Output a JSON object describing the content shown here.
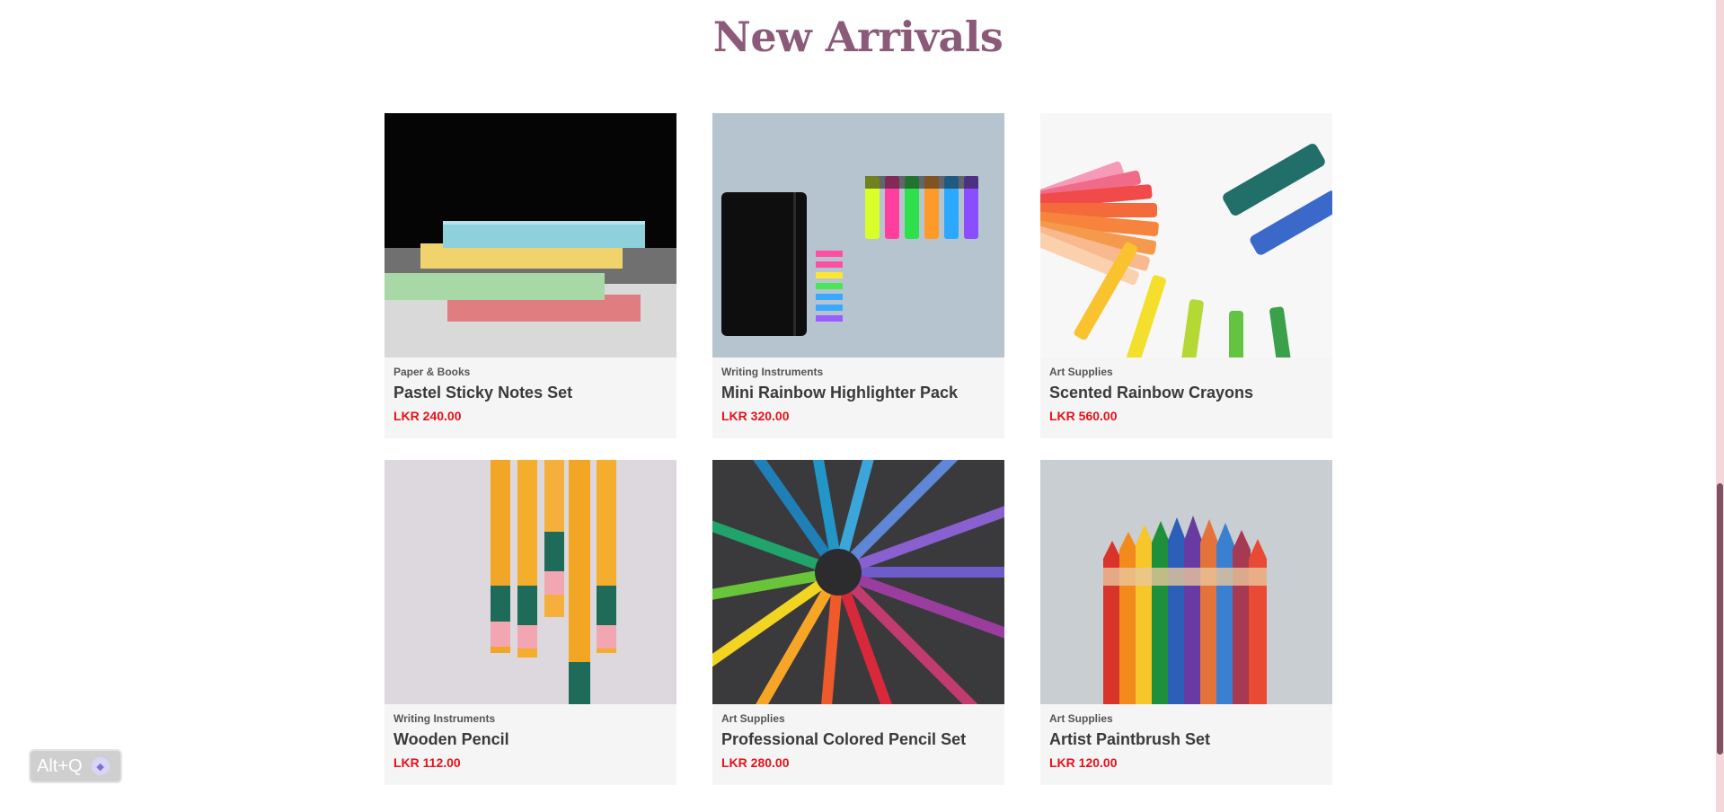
{
  "section": {
    "title": "New Arrivals"
  },
  "products": [
    {
      "category": "Paper & Books",
      "name": "Pastel Sticky Notes Set",
      "price": "LKR 240.00",
      "image": "sticky-notes-photo"
    },
    {
      "category": "Writing Instruments",
      "name": "Mini Rainbow Highlighter Pack",
      "price": "LKR 320.00",
      "image": "highlighters-notebook-photo"
    },
    {
      "category": "Art Supplies",
      "name": "Scented Rainbow Crayons",
      "price": "LKR 560.00",
      "image": "crayons-circle-photo"
    },
    {
      "category": "Writing Instruments",
      "name": "Wooden Pencil",
      "price": "LKR 112.00",
      "image": "yellow-pencils-photo"
    },
    {
      "category": "Art Supplies",
      "name": "Professional Colored Pencil Set",
      "price": "LKR 280.00",
      "image": "colored-pencil-wheel-photo"
    },
    {
      "category": "Art Supplies",
      "name": "Artist Paintbrush Set",
      "price": "LKR 120.00",
      "image": "pencil-bundle-photo"
    }
  ],
  "shortcut": {
    "label": "Alt+Q",
    "icon": "assistant-icon"
  },
  "colors": {
    "title": "#8b5a78",
    "price": "#e8101b",
    "scroll_thumb": "#7d5264",
    "scroll_track": "#f3d7da"
  }
}
